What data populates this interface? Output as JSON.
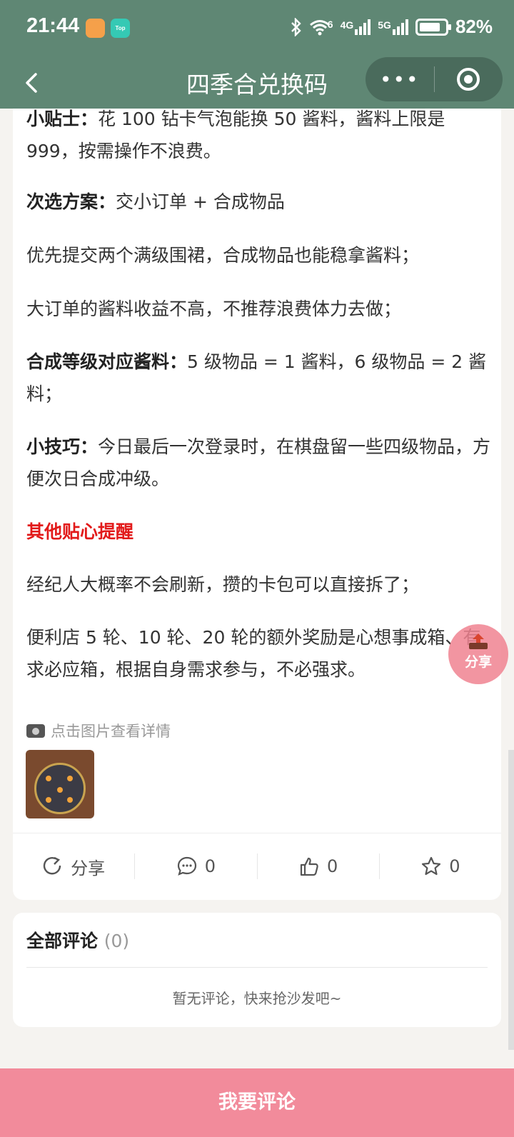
{
  "status_bar": {
    "time": "21:44",
    "app_icon_2": "Top",
    "network_6": "6",
    "network_4g": "4G",
    "network_5g": "5G",
    "battery": "82%"
  },
  "nav": {
    "title": "四季合兑换码",
    "more": "•••"
  },
  "article": {
    "p1_bold": "小贴士：",
    "p1_text": "花 100 钻卡气泡能换 50 酱料，酱料上限是 999，按需操作不浪费。",
    "p2_bold": "次选方案：",
    "p2_text": "交小订单 + 合成物品",
    "p3": "优先提交两个满级围裙，合成物品也能稳拿酱料；",
    "p4": "大订单的酱料收益不高，不推荐浪费体力去做；",
    "p5_bold": "合成等级对应酱料：",
    "p5_text": "5 级物品 = 1 酱料，6 级物品 = 2 酱料；",
    "p6_bold": "小技巧：",
    "p6_text": "今日最后一次登录时，在棋盘留一些四级物品，方便次日合成冲级。",
    "section_red": "其他贴心提醒",
    "p7": "经纪人大概率不会刷新，攒的卡包可以直接拆了；",
    "p8": "便利店 5 轮、10 轮、20 轮的额外奖励是心想事成箱、有求必应箱，根据自身需求参与，不必强求。",
    "image_hint": "点击图片查看详情"
  },
  "actions": {
    "share": "分享",
    "comments": "0",
    "likes": "0",
    "favorites": "0"
  },
  "comments": {
    "title": "全部评论",
    "count": "(0)",
    "empty": "暂无评论，快来抢沙发吧~"
  },
  "float_share": "分享",
  "bottom_button": "我要评论",
  "colors": {
    "header": "#5f8774",
    "accent_red": "#e21a1a",
    "bottom_button": "#f28b9b"
  }
}
